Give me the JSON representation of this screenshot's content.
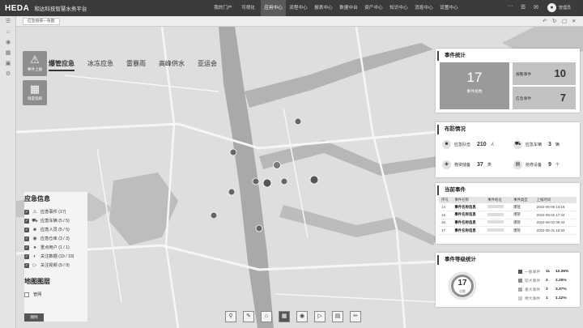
{
  "topbar": {
    "logo": "HEDA",
    "app_title": "和达科技智慧水务平台",
    "nav": [
      "我的门户",
      "可视化",
      "应用中心",
      "流程中心",
      "报表中心",
      "数据中台",
      "资产中心",
      "知识中心",
      "消息中心",
      "设置中心"
    ],
    "active_nav_index": 2,
    "more": "···",
    "user_name": "管理员"
  },
  "breadcrumb_tab": "应急指挥一张图",
  "scene_tabs": [
    "爆管应急",
    "冰冻应急",
    "雷暴雨",
    "高峰供水",
    "亚运会"
  ],
  "active_scene_index": 0,
  "quick_buttons": [
    {
      "label": "事件上报",
      "icon": "warning-icon"
    },
    {
      "label": "调度指挥",
      "icon": "dispatch-icon"
    }
  ],
  "legend": {
    "title": "应急信息",
    "items": [
      {
        "label": "应急事件",
        "count": "(17)",
        "icon": "warning-icon"
      },
      {
        "label": "应急车辆",
        "count": "(5 / 5)",
        "icon": "vehicle-icon"
      },
      {
        "label": "应急人员",
        "count": "(5 / 5)",
        "icon": "person-icon"
      },
      {
        "label": "应急仓库",
        "count": "(3 / 3)",
        "icon": "warehouse-icon"
      },
      {
        "label": "重点用户",
        "count": "(1 / 1)",
        "icon": "key-user-icon"
      },
      {
        "label": "关注数据",
        "count": "(19 / 19)",
        "icon": "data-icon"
      },
      {
        "label": "关注视频",
        "count": "(9 / 9)",
        "icon": "video-icon"
      }
    ],
    "layer_title": "地图图层",
    "layer_items": [
      {
        "label": "管网"
      }
    ]
  },
  "bottom_left_button": "图例",
  "toolbar_tools": [
    "search-tool-icon",
    "measure-tool-icon",
    "building-tool-icon",
    "grid-tool-icon",
    "globe-tool-icon",
    "video-tool-icon",
    "document-tool-icon",
    "edit-tool-icon"
  ],
  "active_tool_index": 3,
  "event_stats": {
    "title": "事件统计",
    "total": "17",
    "total_label": "事件总数",
    "reported": {
      "label": "报警事件",
      "value": "10"
    },
    "emergency": {
      "label": "应急事件",
      "value": "7"
    }
  },
  "deployment": {
    "title": "布防情况",
    "items": [
      {
        "label": "应急队伍",
        "value": "210",
        "unit": "人",
        "icon": "team-icon"
      },
      {
        "label": "应急车辆",
        "value": "3",
        "unit": "辆",
        "icon": "truck-icon"
      },
      {
        "label": "物资储备",
        "value": "37",
        "unit": "类",
        "icon": "materials-icon"
      },
      {
        "label": "抢修设备",
        "value": "9",
        "unit": "个",
        "icon": "equipment-icon"
      }
    ]
  },
  "current_events": {
    "title": "当前事件",
    "columns": [
      "序号",
      "事件名称",
      "事件地址",
      "事件类型",
      "上报时间"
    ],
    "rows": [
      {
        "no": "14",
        "name": "事件名称信息",
        "type": "爆管",
        "time": "2022-06-06 14:16"
      },
      {
        "no": "15",
        "name": "事件名称信息",
        "type": "爆管",
        "time": "2022-06-02 17:24"
      },
      {
        "no": "16",
        "name": "事件名称信息",
        "type": "爆管",
        "time": "2022-06-02 09:44"
      },
      {
        "no": "17",
        "name": "事件名称信息",
        "type": "爆管",
        "time": "2022-05-31 10:53"
      }
    ]
  },
  "event_levels": {
    "title": "事件等级统计",
    "total": "17",
    "total_label": "总数",
    "levels": [
      {
        "name": "一般事件",
        "count": "11",
        "pct": "12.36%",
        "color": "#555555"
      },
      {
        "name": "较大事件",
        "count": "2",
        "pct": "2.25%",
        "color": "#8a8a8a"
      },
      {
        "name": "重大事件",
        "count": "3",
        "pct": "3.37%",
        "color": "#aaaaaa"
      },
      {
        "name": "特大事件",
        "count": "1",
        "pct": "1.12%",
        "color": "#cccccc"
      }
    ]
  }
}
